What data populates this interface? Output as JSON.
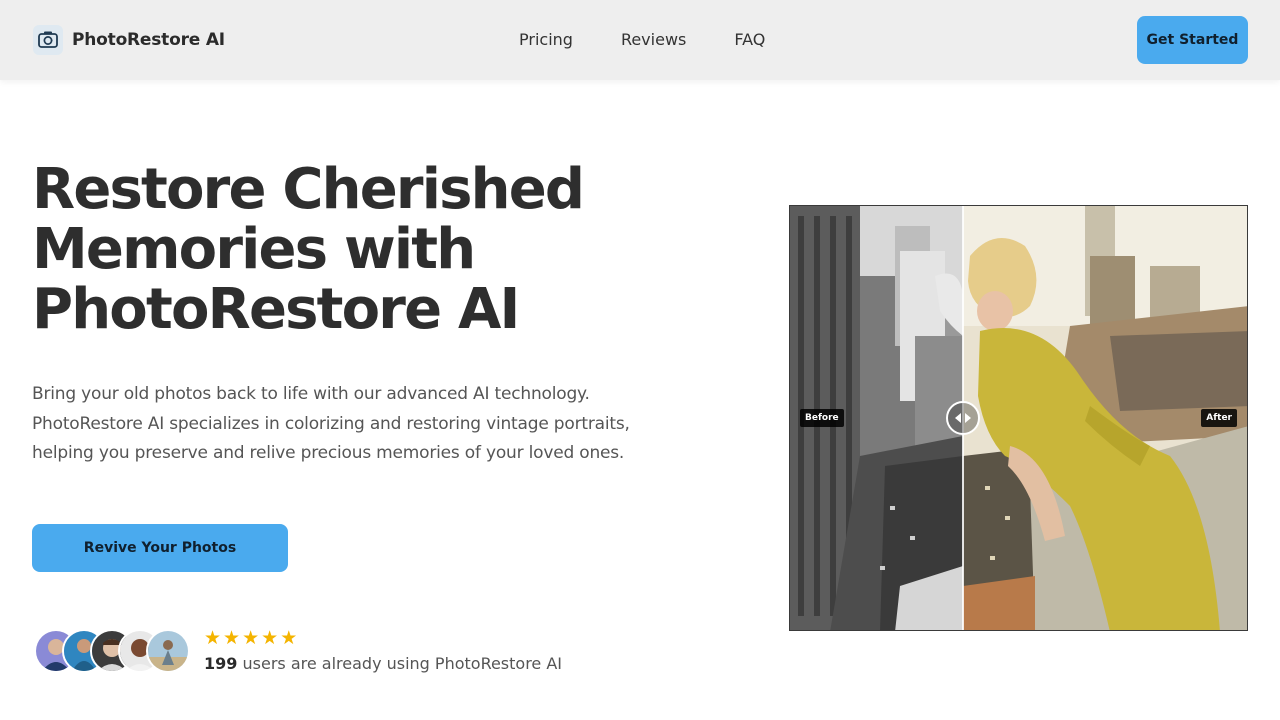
{
  "header": {
    "brand_name": "PhotoRestore AI",
    "brand_icon": "camera-restore-icon",
    "nav": [
      {
        "label": "Pricing"
      },
      {
        "label": "Reviews"
      },
      {
        "label": "FAQ"
      }
    ],
    "cta_label": "Get Started"
  },
  "hero": {
    "title_lines": [
      "Restore Cherished",
      "Memories with",
      "PhotoRestore AI"
    ],
    "subtitle_lines": [
      "Bring your old photos back to life with our advanced AI technology.",
      "PhotoRestore AI specializes in colorizing and restoring vintage portraits,",
      "helping you preserve and relive precious memories of your loved ones."
    ],
    "cta_label": "Revive Your Photos"
  },
  "social_proof": {
    "rating_stars": 5,
    "user_count": "199",
    "text": "users are already using PhotoRestore AI"
  },
  "comparison": {
    "before_label": "Before",
    "after_label": "After",
    "handle_icon": "left-right-arrows-icon"
  },
  "colors": {
    "accent": "#4aaaee",
    "header_bg": "#eeeeee",
    "star": "#f4b400",
    "text_dark": "#2e2e2e"
  }
}
